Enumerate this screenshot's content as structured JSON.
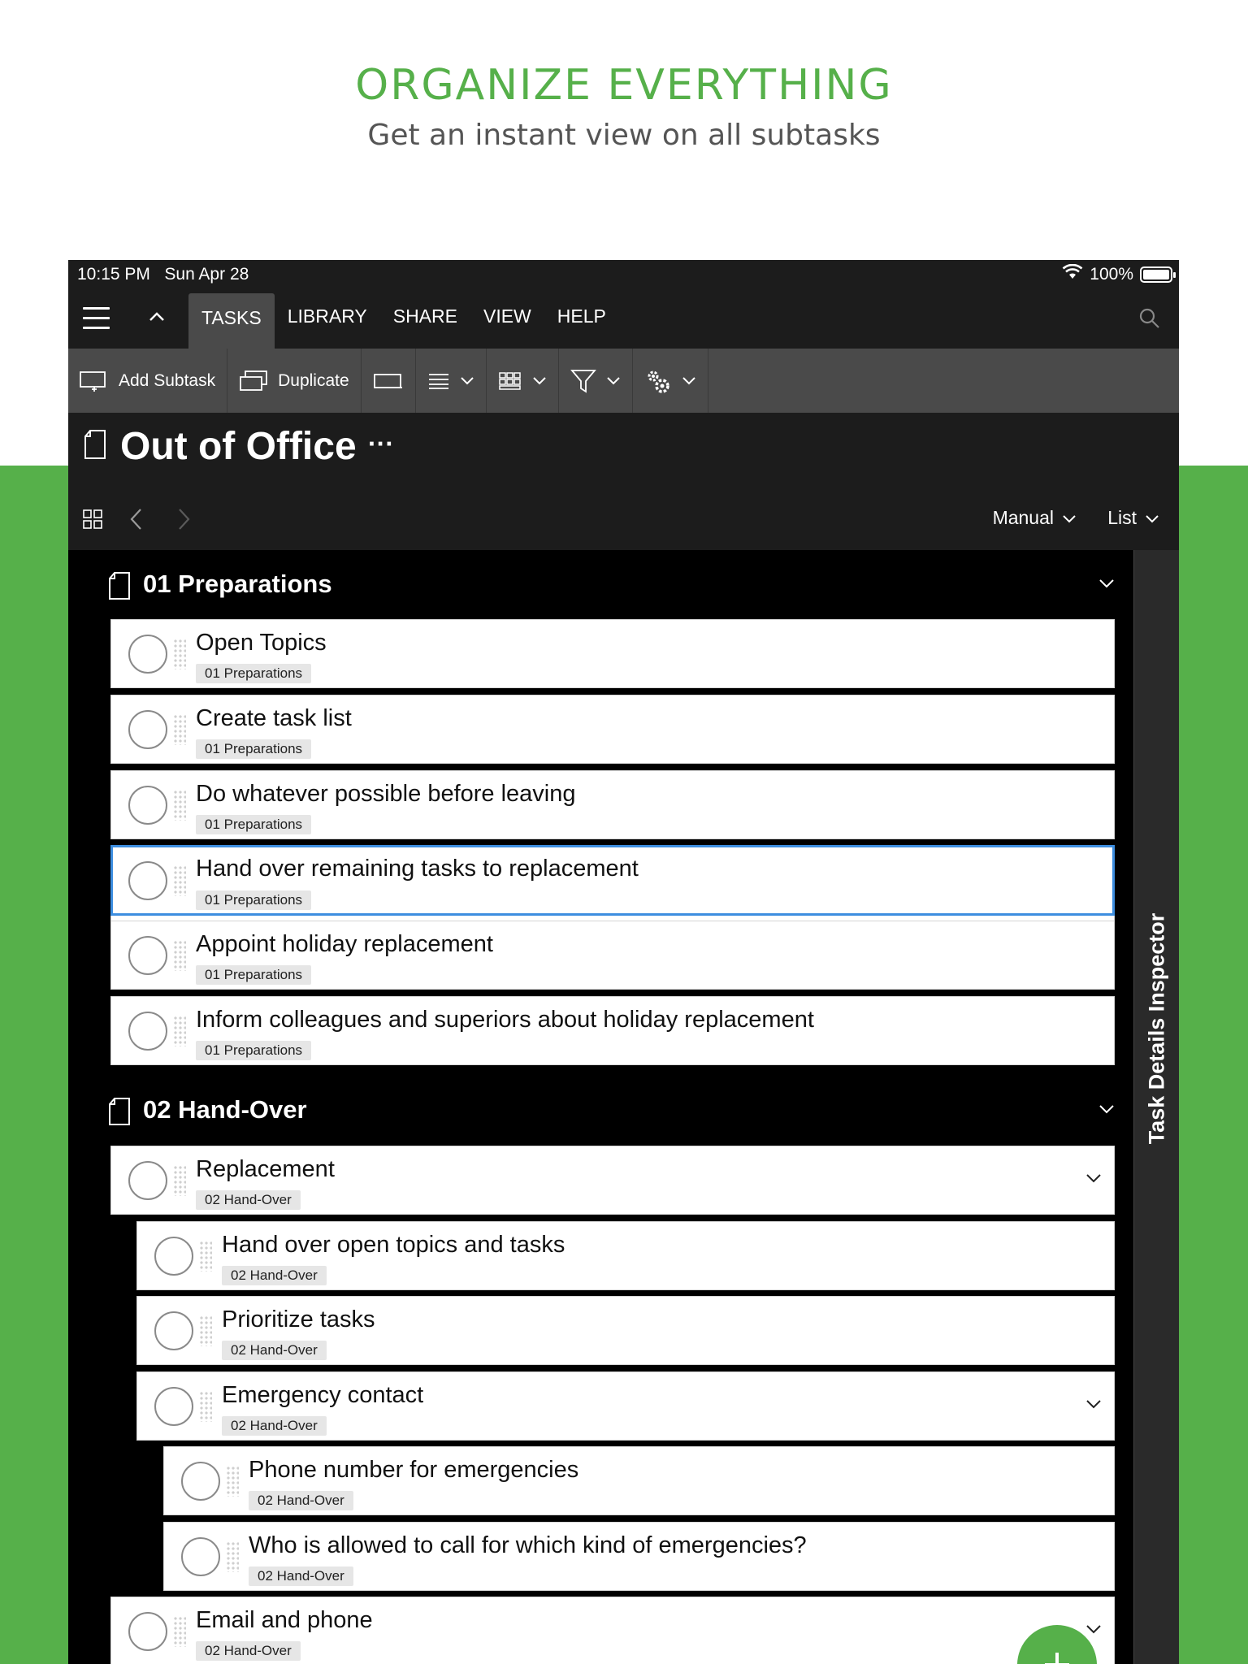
{
  "promo": {
    "title": "ORGANIZE EVERYTHING",
    "subtitle": "Get an instant view on all subtasks"
  },
  "status_bar": {
    "time": "10:15 PM   Sun Apr 28",
    "battery": "100%"
  },
  "menu": {
    "tabs": [
      "TASKS",
      "LIBRARY",
      "SHARE",
      "VIEW",
      "HELP"
    ],
    "active_tab": "TASKS"
  },
  "toolbar": {
    "add_subtask": "Add Subtask",
    "duplicate": "Duplicate"
  },
  "document": {
    "title": "Out of Office",
    "more": "···"
  },
  "navbar": {
    "sort": "Manual",
    "view": "List"
  },
  "inspector": {
    "label": "Task Details Inspector"
  },
  "sections": [
    {
      "name": "01 Preparations"
    },
    {
      "name": "02 Hand-Over"
    }
  ],
  "tasks": [
    {
      "name": "Open Topics",
      "tag": "01 Preparations"
    },
    {
      "name": "Create task list",
      "tag": "01 Preparations"
    },
    {
      "name": "Do whatever possible before leaving",
      "tag": "01 Preparations"
    },
    {
      "name": "Hand over remaining tasks to replacement",
      "tag": "01 Preparations",
      "selected": true
    },
    {
      "name": "Appoint holiday replacement",
      "tag": "01 Preparations"
    },
    {
      "name": "Inform colleagues and superiors about holiday replacement",
      "tag": "01 Preparations"
    },
    {
      "name": "Replacement",
      "tag": "02 Hand-Over",
      "expandable": true
    },
    {
      "name": "Hand over open topics and tasks",
      "tag": "02 Hand-Over"
    },
    {
      "name": "Prioritize tasks",
      "tag": "02 Hand-Over"
    },
    {
      "name": "Emergency contact",
      "tag": "02 Hand-Over",
      "expandable": true
    },
    {
      "name": "Phone number for emergencies",
      "tag": "02 Hand-Over"
    },
    {
      "name": "Who is allowed to call for which kind of emergencies?",
      "tag": "02 Hand-Over"
    },
    {
      "name": "Email and phone",
      "tag": "02 Hand-Over",
      "expandable": true
    }
  ],
  "colors": {
    "brand_green": "#56b04a",
    "selection_blue": "#3d8ee0"
  }
}
